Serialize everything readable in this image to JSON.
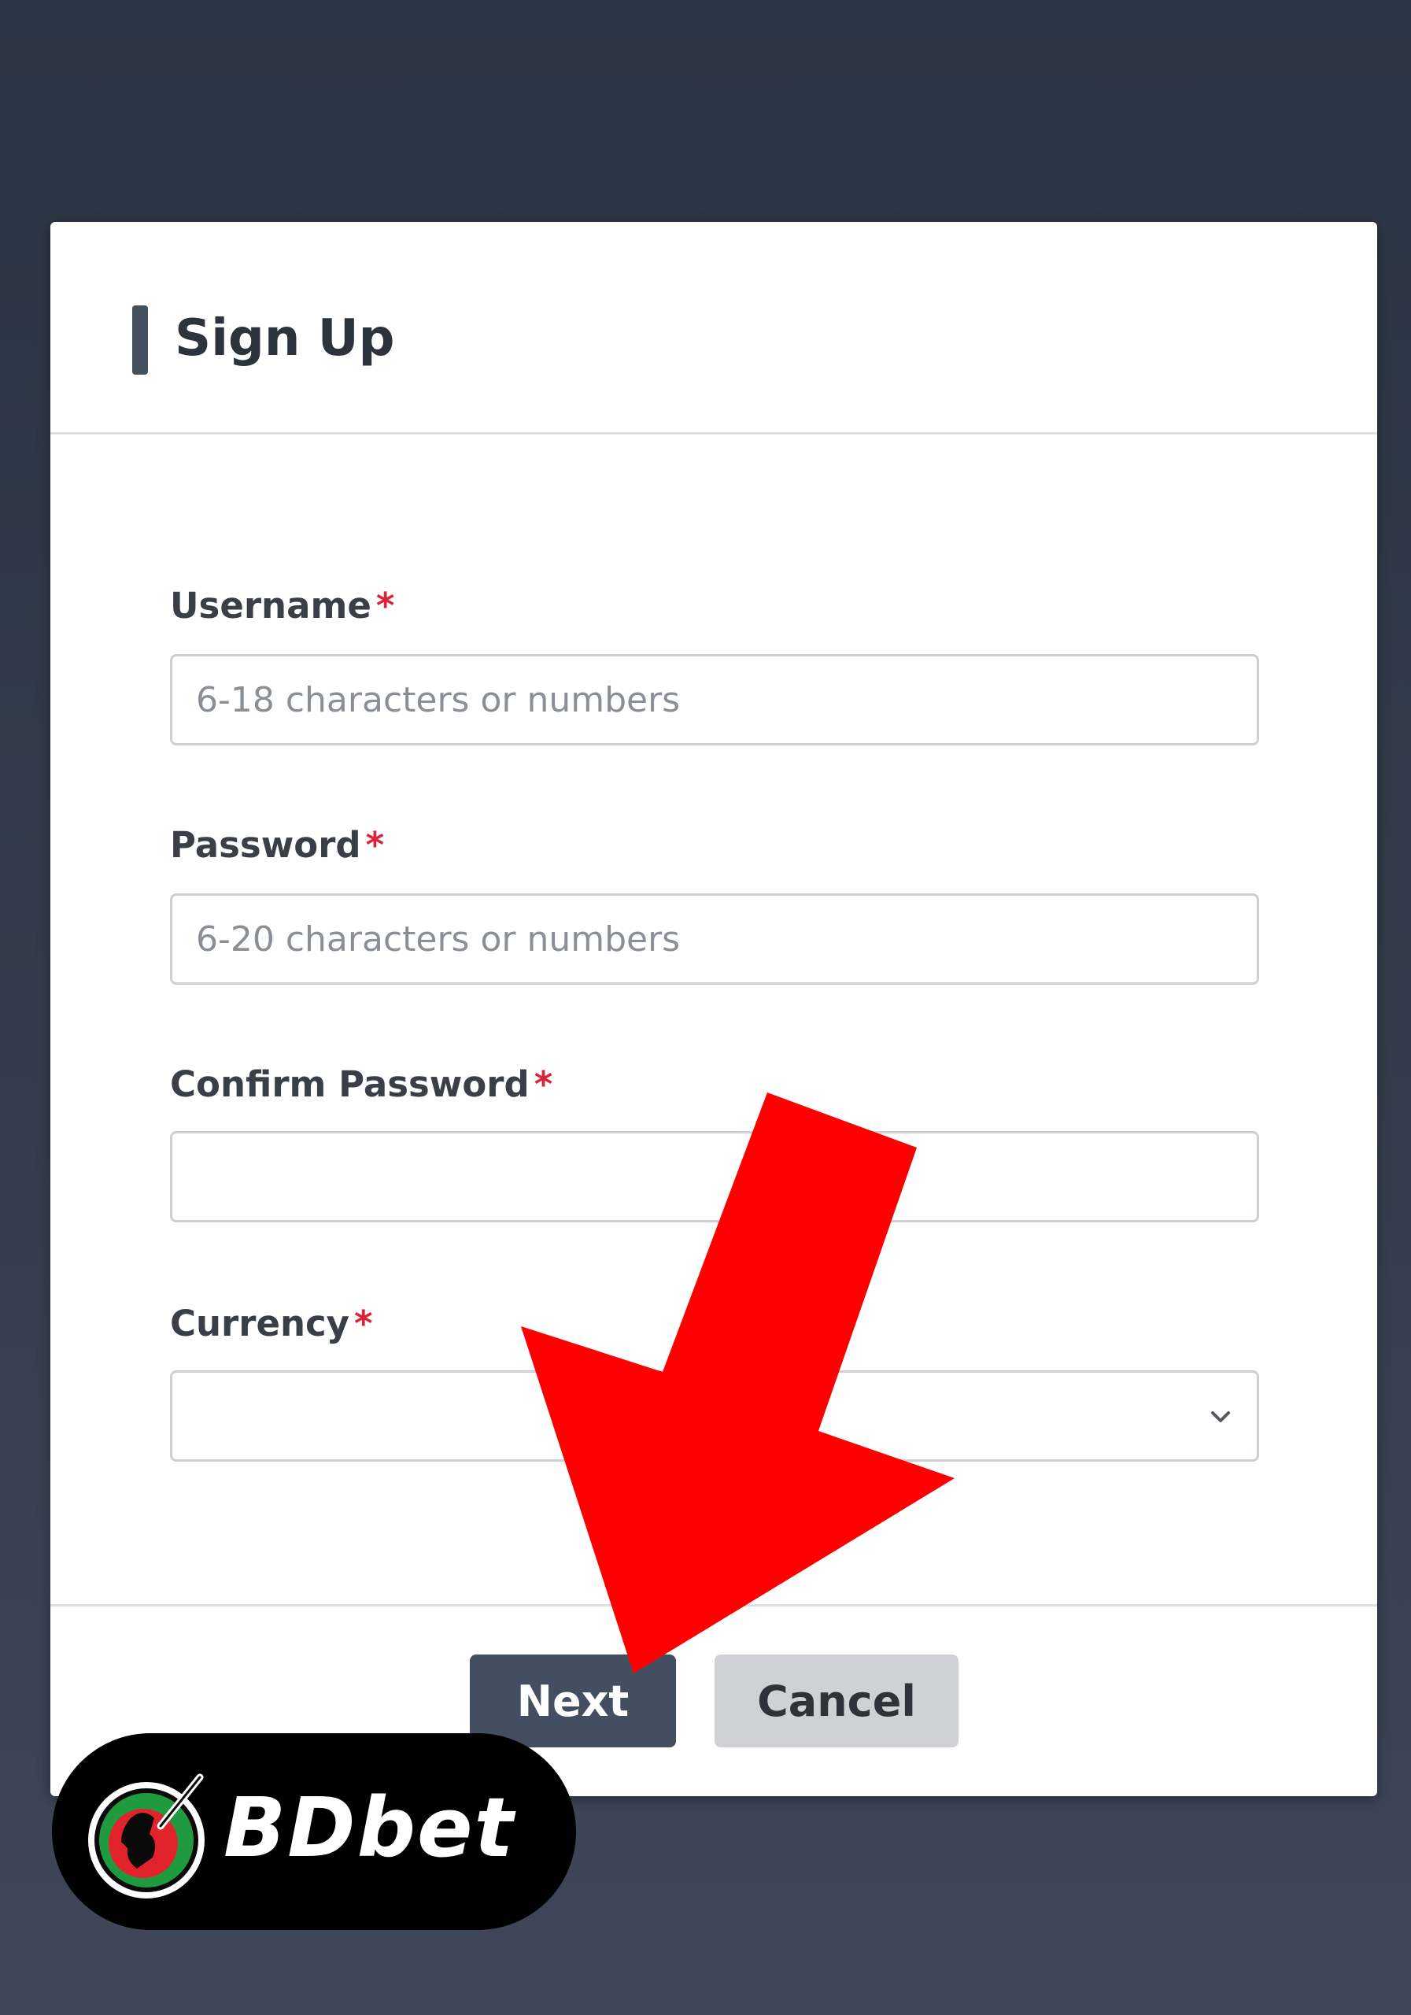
{
  "modal": {
    "title": "Sign Up"
  },
  "form": {
    "username": {
      "label": "Username",
      "required_mark": "*",
      "placeholder": "6-18 characters or numbers",
      "value": ""
    },
    "password": {
      "label": "Password",
      "required_mark": "*",
      "placeholder": "6-20 characters or numbers",
      "value": ""
    },
    "confirm_password": {
      "label": "Confirm Password",
      "required_mark": "*",
      "placeholder": "",
      "value": ""
    },
    "currency": {
      "label": "Currency",
      "required_mark": "*",
      "selected": ""
    }
  },
  "buttons": {
    "next_label": "Next",
    "cancel_label": "Cancel"
  },
  "overlay": {
    "arrow_color": "#ff0000"
  },
  "brand": {
    "logo_text": "BDbet",
    "emblem_icon": "cricket-batsman-icon"
  },
  "colors": {
    "background": "#343c4b",
    "primary_button": "#434e60",
    "secondary_button": "#cfd1d4",
    "required": "#d9233a"
  }
}
